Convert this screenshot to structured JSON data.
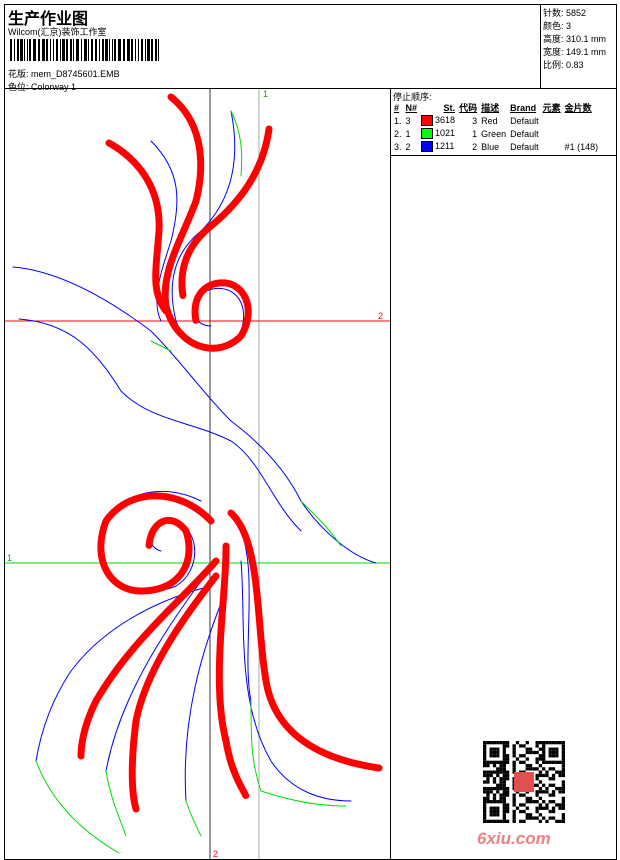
{
  "header": {
    "title": "生产作业图",
    "studio": "Wilcom(汇京)装饰工作室",
    "design_label": "花版:",
    "design_value": "mem_D8745601.EMB",
    "colorway_label": "色位:",
    "colorway_value": "Colorway 1"
  },
  "stats": [
    {
      "label": "针数:",
      "value": "5852"
    },
    {
      "label": "颜色:",
      "value": "3"
    },
    {
      "label": "高度:",
      "value": "310.1 mm"
    },
    {
      "label": "宽度:",
      "value": "149.1 mm"
    },
    {
      "label": "比例:",
      "value": "0.83"
    }
  ],
  "panel": {
    "stop_title": "停止顺序:",
    "columns": [
      "#",
      "N#",
      "St.",
      "代码",
      "描述",
      "Brand",
      "元素",
      "金片数"
    ],
    "rows": [
      {
        "idx": "1.",
        "n": "3",
        "color": "#ff0000",
        "st": "3618",
        "code": "3",
        "desc": "Red",
        "brand": "Default",
        "elem": "",
        "seq": ""
      },
      {
        "idx": "2.",
        "n": "1",
        "color": "#00ff00",
        "st": "1021",
        "code": "1",
        "desc": "Green",
        "brand": "Default",
        "elem": "",
        "seq": ""
      },
      {
        "idx": "3.",
        "n": "2",
        "color": "#0000ff",
        "st": "1211",
        "code": "2",
        "desc": "Blue",
        "brand": "Default",
        "elem": "",
        "seq": "#1 (148)"
      }
    ]
  },
  "canvas": {
    "marker_top": "1",
    "marker_right": "2",
    "marker_left": "1",
    "marker_bottom": "2"
  },
  "watermark": "6xiu.com"
}
